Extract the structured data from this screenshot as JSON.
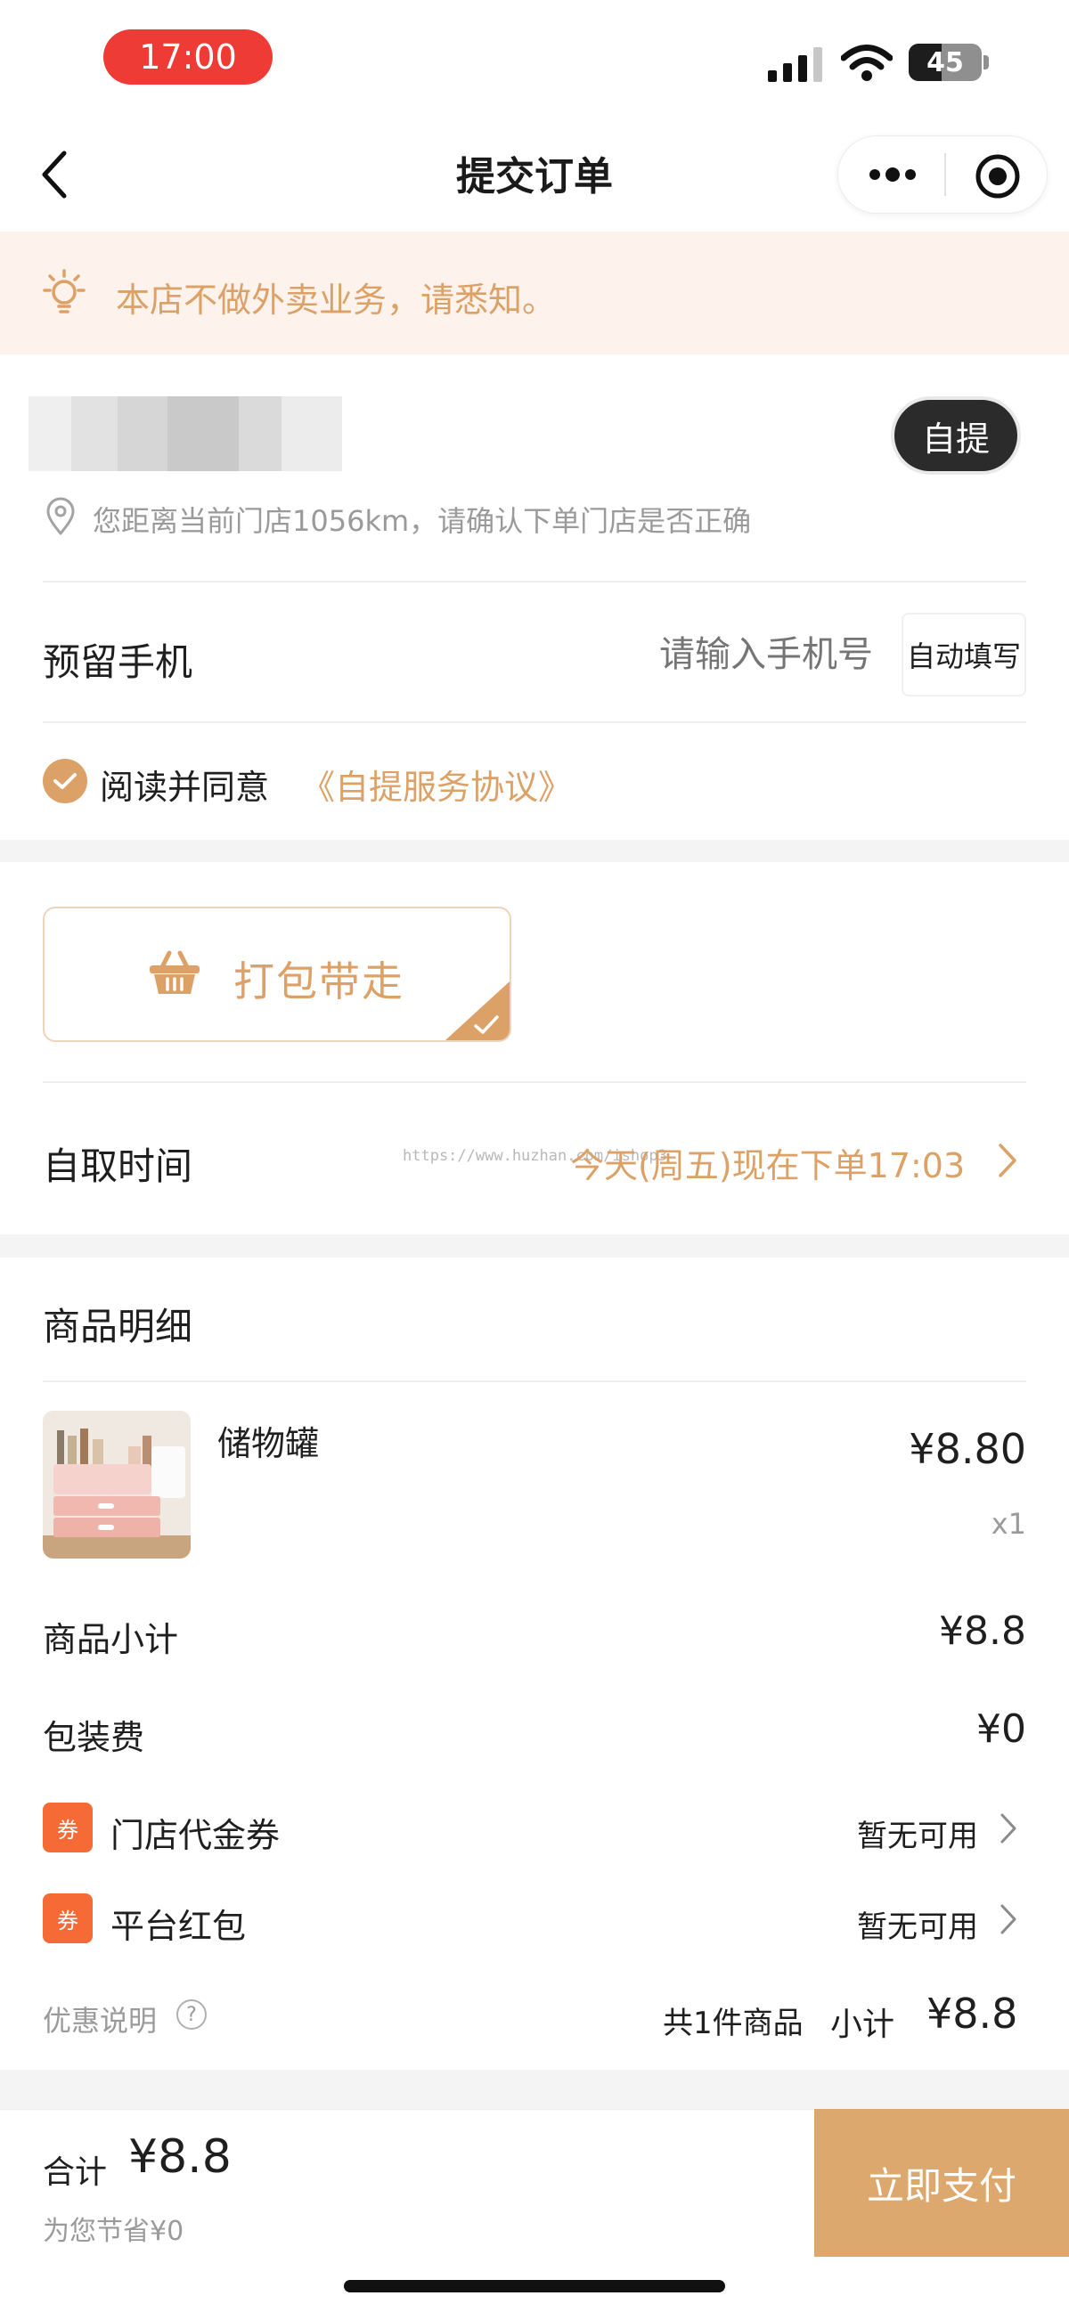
{
  "status_bar": {
    "time": "17:00",
    "battery": "45",
    "battery_level": 0.45
  },
  "nav": {
    "title": "提交订单"
  },
  "notice": {
    "text": "本店不做外卖业务，请悉知。"
  },
  "store": {
    "pickup_label": "自提",
    "distance_text": "您距离当前门店1056km，请确认下单门店是否正确"
  },
  "phone": {
    "label": "预留手机",
    "placeholder": "请输入手机号",
    "autofill_label": "自动填写"
  },
  "agreement": {
    "prefix": "阅读并同意",
    "link": "《自提服务协议》",
    "checked": true
  },
  "delivery_option": {
    "label": "打包带走",
    "selected": true
  },
  "pickup_time": {
    "label": "自取时间",
    "value": "今天(周五)现在下单17:03",
    "watermark": "https://www.huzhan.com/ishop3"
  },
  "goods": {
    "title": "商品明细",
    "items": [
      {
        "name": "储物罐",
        "price": "¥8.80",
        "qty": "x1"
      }
    ],
    "subtotal_label": "商品小计",
    "subtotal_value": "¥8.8",
    "packing_label": "包装费",
    "packing_value": "¥0",
    "coupons": [
      {
        "tag": "券",
        "label": "门店代金券",
        "value": "暂无可用"
      },
      {
        "tag": "券",
        "label": "平台红包",
        "value": "暂无可用"
      }
    ],
    "discount_note": "优惠说明",
    "count_text": "共1件商品",
    "subtotal_short_label": "小计",
    "subtotal_short_value": "¥8.8"
  },
  "bottom_bar": {
    "total_label": "合计",
    "total_value": "¥8.8",
    "saved_text": "为您节省¥0",
    "pay_label": "立即支付"
  },
  "colors": {
    "accent": "#dca167",
    "coupon": "#f66a36",
    "notice_bg": "#fdf2ec",
    "pay_button": "#dca86d"
  }
}
